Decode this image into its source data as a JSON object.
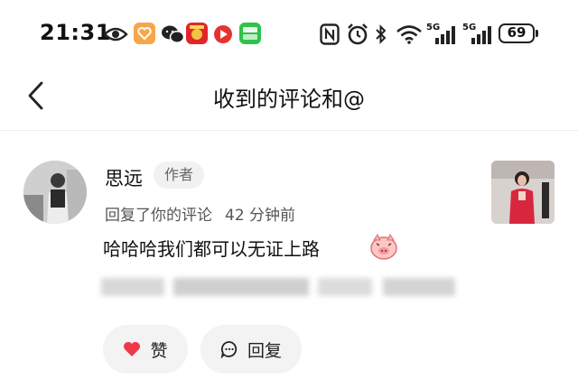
{
  "status_bar": {
    "time": "21:31",
    "battery": "69",
    "network_1": "5G",
    "network_2": "5G"
  },
  "header": {
    "title": "收到的评论和@"
  },
  "comment": {
    "author": "思远",
    "author_badge": "作者",
    "action": "回复了你的评论",
    "time_ago": "42 分钟前",
    "text": "哈哈哈我们都可以无证上路",
    "emoji": "pig-emoji"
  },
  "actions": {
    "like_label": "赞",
    "reply_label": "回复"
  },
  "colors": {
    "accent": "#f0384b",
    "pill_bg": "#f3f3f3"
  }
}
